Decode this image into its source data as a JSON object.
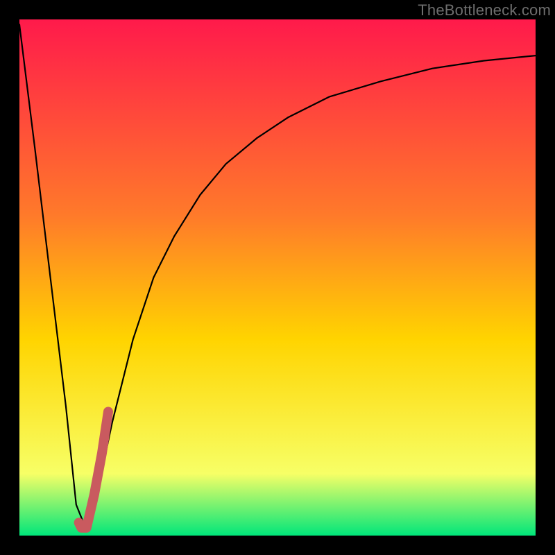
{
  "watermark": "TheBottleneck.com",
  "colors": {
    "gradient_top": "#ff1a4b",
    "gradient_mid1": "#ff7a2a",
    "gradient_mid2": "#ffd400",
    "gradient_mid3": "#f7ff66",
    "gradient_bottom": "#00e67a",
    "curve": "#000000",
    "highlight": "#c95a5f",
    "frame": "#000000"
  },
  "chart_data": {
    "type": "line",
    "title": "",
    "xlabel": "",
    "ylabel": "",
    "xlim": [
      0,
      100
    ],
    "ylim": [
      0,
      100
    ],
    "series": [
      {
        "name": "bottleneck-curve",
        "x": [
          0,
          3,
          6,
          9,
          11,
          13,
          15,
          18,
          22,
          26,
          30,
          35,
          40,
          46,
          52,
          60,
          70,
          80,
          90,
          100
        ],
        "y": [
          99,
          75,
          50,
          25,
          6,
          1,
          8,
          22,
          38,
          50,
          58,
          66,
          72,
          77,
          81,
          85,
          88,
          90.5,
          92,
          93
        ]
      },
      {
        "name": "highlight-segment",
        "x": [
          11.5,
          12,
          13,
          14.5,
          16,
          17.2
        ],
        "y": [
          2.5,
          1.5,
          1.5,
          8,
          16,
          24
        ]
      }
    ]
  }
}
